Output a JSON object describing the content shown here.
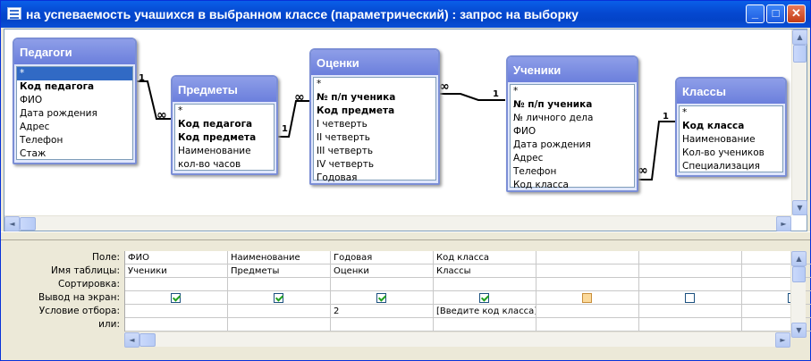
{
  "window": {
    "title": "на успеваемость учашихся в выбранном классе (параметрический) : запрос на выборку",
    "min": "_",
    "max": "□",
    "close": "✕"
  },
  "tables": [
    {
      "name": "Педагоги",
      "fields": [
        {
          "t": "*",
          "b": false,
          "sel": true
        },
        {
          "t": "Код педагога",
          "b": true
        },
        {
          "t": "ФИО",
          "b": false
        },
        {
          "t": "Дата рождения",
          "b": false
        },
        {
          "t": "Адрес",
          "b": false
        },
        {
          "t": "Телефон",
          "b": false
        },
        {
          "t": "Стаж",
          "b": false
        }
      ]
    },
    {
      "name": "Предметы",
      "fields": [
        {
          "t": "*",
          "b": false
        },
        {
          "t": "Код педагога",
          "b": true
        },
        {
          "t": "Код предмета",
          "b": true
        },
        {
          "t": "Наименование",
          "b": false
        },
        {
          "t": "кол-во часов",
          "b": false
        }
      ]
    },
    {
      "name": "Оценки",
      "fields": [
        {
          "t": "*",
          "b": false
        },
        {
          "t": "№ п/п ученика",
          "b": true
        },
        {
          "t": "Код предмета",
          "b": true
        },
        {
          "t": "I четверть",
          "b": false
        },
        {
          "t": "II четверть",
          "b": false
        },
        {
          "t": "III четверть",
          "b": false
        },
        {
          "t": "IV четверть",
          "b": false
        },
        {
          "t": "Годовая",
          "b": false
        }
      ]
    },
    {
      "name": "Ученики",
      "fields": [
        {
          "t": "*",
          "b": false
        },
        {
          "t": "№ п/п ученика",
          "b": true
        },
        {
          "t": "№ личного дела",
          "b": false
        },
        {
          "t": "ФИО",
          "b": false
        },
        {
          "t": "Дата рождения",
          "b": false
        },
        {
          "t": "Адрес",
          "b": false
        },
        {
          "t": "Телефон",
          "b": false
        },
        {
          "t": "Код класса",
          "b": false
        }
      ]
    },
    {
      "name": "Классы",
      "fields": [
        {
          "t": "*",
          "b": false
        },
        {
          "t": "Код класса",
          "b": true
        },
        {
          "t": "Наименование",
          "b": false
        },
        {
          "t": "Кол-во учеников",
          "b": false
        },
        {
          "t": "Специализация",
          "b": false
        }
      ]
    }
  ],
  "relations": {
    "one": "1",
    "many": "∞"
  },
  "grid": {
    "row_labels": [
      "Поле:",
      "Имя таблицы:",
      "Сортировка:",
      "Вывод на экран:",
      "Условие отбора:",
      "или:"
    ],
    "columns": [
      {
        "field": "ФИО",
        "table": "Ученики",
        "sort": "",
        "show": true,
        "criteria": "",
        "or": ""
      },
      {
        "field": "Наименование",
        "table": "Предметы",
        "sort": "",
        "show": true,
        "criteria": "",
        "or": ""
      },
      {
        "field": "Годовая",
        "table": "Оценки",
        "sort": "",
        "show": true,
        "criteria": "2",
        "or": ""
      },
      {
        "field": "Код класса",
        "table": "Классы",
        "sort": "",
        "show": true,
        "criteria": "[Введите код класса]",
        "or": ""
      },
      {
        "field": "",
        "table": "",
        "sort": "",
        "show": false,
        "criteria": "",
        "or": "",
        "hi": true
      },
      {
        "field": "",
        "table": "",
        "sort": "",
        "show": false,
        "criteria": "",
        "or": ""
      },
      {
        "field": "",
        "table": "",
        "sort": "",
        "show": false,
        "criteria": "",
        "or": ""
      }
    ]
  },
  "scroll": {
    "up": "▲",
    "down": "▼",
    "left": "◄",
    "right": "►"
  }
}
